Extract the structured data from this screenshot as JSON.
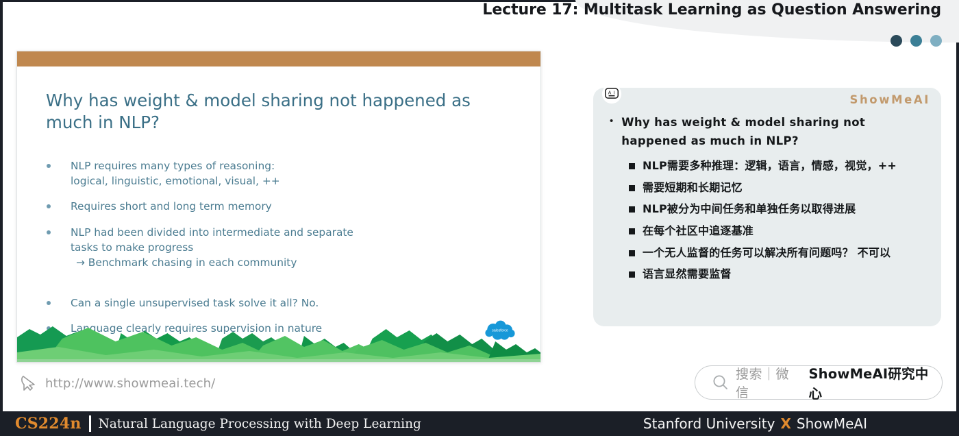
{
  "header": {
    "title": "Lecture 17: Multitask Learning as Question Answering",
    "dots": [
      {
        "name": "dot-dark",
        "color": "#2b4a5a"
      },
      {
        "name": "dot-medium",
        "color": "#3b7f96"
      },
      {
        "name": "dot-light",
        "color": "#7fafc2"
      }
    ]
  },
  "slide": {
    "accent_bar_color": "#c0884f",
    "title": "Why has weight & model sharing not happened as much in NLP?",
    "bullets": [
      {
        "text": "NLP requires many types of reasoning:",
        "sub": "logical, linguistic, emotional, visual, ++",
        "arrow": ""
      },
      {
        "text": "Requires short and long term memory",
        "sub": "",
        "arrow": ""
      },
      {
        "text": "NLP had been divided into intermediate and separate",
        "sub": "tasks to make progress",
        "arrow": "→ Benchmark chasing in each community"
      },
      {
        "text": "Can a single unsupervised task solve it all? No.",
        "sub": "",
        "arrow": ""
      },
      {
        "text": "Language clearly requires supervision in nature",
        "sub": "",
        "arrow": ""
      }
    ],
    "logo_label": "salesforce"
  },
  "note_panel": {
    "ai_icon_label": "A I",
    "brand": "ShowMeAI",
    "main_bullet_marker": "•",
    "main_text": "Why has weight & model sharing not happened as much in NLP?",
    "sub_items": [
      "NLP需要多种推理：逻辑，语言，情感，视觉，++",
      "需要短期和长期记忆",
      "NLP被分为中间任务和单独任务以取得进展",
      "在每个社区中追逐基准",
      "一个无人监督的任务可以解决所有问题吗？ 不可以",
      "语言显然需要监督"
    ]
  },
  "footer_link": {
    "url": "http://www.showmeai.tech/",
    "icon": "cursor-icon"
  },
  "wechat": {
    "icon": "search-icon",
    "grey_text": "搜索｜微信",
    "bold_text": "ShowMeAI研究中心"
  },
  "bottom_bar": {
    "course_code": "CS224n",
    "course_title": "Natural Language Processing with Deep Learning",
    "right_left": "Stanford University",
    "right_x": "X",
    "right_right": "ShowMeAI",
    "accent_color": "#e08a2e",
    "background": "#1b1f27"
  }
}
